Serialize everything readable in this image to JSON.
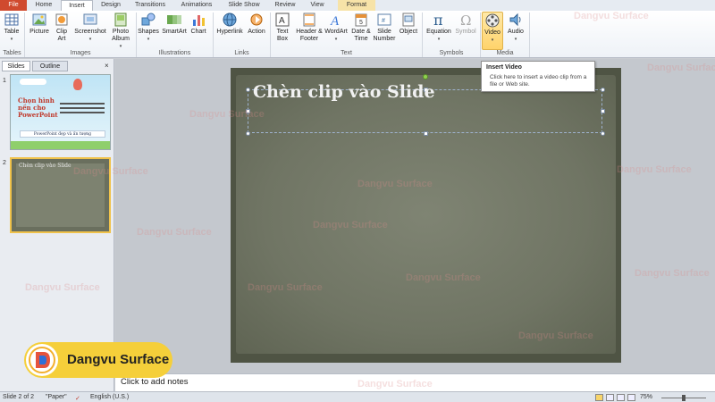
{
  "tabs": [
    "File",
    "Home",
    "Insert",
    "Design",
    "Transitions",
    "Animations",
    "Slide Show",
    "Review",
    "View",
    "Format"
  ],
  "ribbon": {
    "buttons": [
      "Table",
      "Picture",
      "Clip Art",
      "Screenshot",
      "Photo Album",
      "Shapes",
      "SmartArt",
      "Chart",
      "Hyperlink",
      "Action",
      "Text Box",
      "Header & Footer",
      "WordArt",
      "Date & Time",
      "Slide Number",
      "Object",
      "Equation",
      "Symbol",
      "Video",
      "Audio"
    ],
    "groups": [
      "Tables",
      "Images",
      "Illustrations",
      "Links",
      "Text",
      "Symbols",
      "Media"
    ]
  },
  "tooltip": {
    "title": "Insert Video",
    "desc": "Click here to insert a video clip from a file or Web site."
  },
  "pane": {
    "tabs": [
      "Slides",
      "Outline"
    ],
    "close": "×",
    "slide_numbers": [
      "1",
      "2"
    ],
    "thumb1": {
      "lines": [
        "Chọn hình",
        "nền cho",
        "PowerPoint"
      ],
      "footer": "PowerPoint đẹp và ấn tượng"
    },
    "thumb2_title": "Chèn clip vào Slide"
  },
  "slide": {
    "title": "Chèn clip vào Slide"
  },
  "notes": {
    "placeholder": "Click to add notes"
  },
  "status": {
    "slide": "Slide 2 of 2",
    "theme": "\"Paper\"",
    "lang": "English (U.S.)",
    "zoom": "75%"
  },
  "logo": {
    "text": "Dangvu Surface"
  },
  "watermark": "Dangvu Surface",
  "colors": {
    "file_tab": "#d04a2e",
    "format_tab": "#f7e3a8",
    "logo_bg": "#f5cf3a",
    "selected_button": "#ffd36b"
  }
}
